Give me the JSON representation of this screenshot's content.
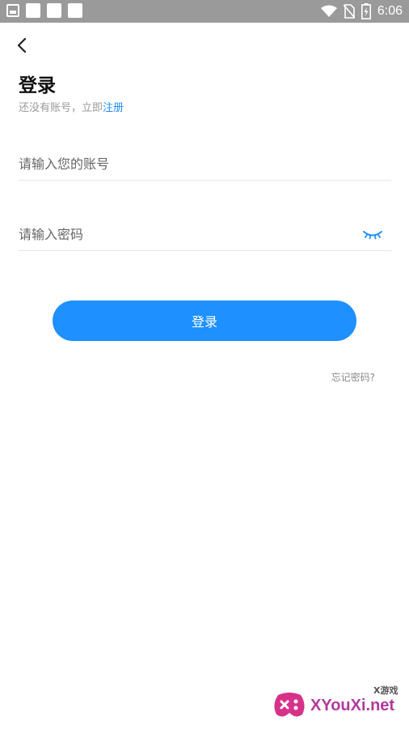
{
  "status_bar": {
    "time": "6:06",
    "icons": [
      "image-icon",
      "app-icon",
      "app-icon",
      "app-icon",
      "wifi-icon",
      "no-sim-icon",
      "battery-charging-icon"
    ]
  },
  "header": {
    "back_icon": "chevron-left-icon",
    "title": "登录",
    "subtitle_prefix": "还没有账号，立即",
    "register_link": "注册"
  },
  "form": {
    "account_placeholder": "请输入您的账号",
    "password_placeholder": "请输入密码",
    "eye_icon": "eye-closed-icon",
    "submit_label": "登录",
    "forgot_label": "忘记密码?"
  },
  "colors": {
    "accent": "#1e90ff",
    "link": "#1d8df4",
    "status_bar": "#9a9a9a"
  },
  "watermark": {
    "site": "XYouXi.net",
    "cn": "X游戏"
  }
}
